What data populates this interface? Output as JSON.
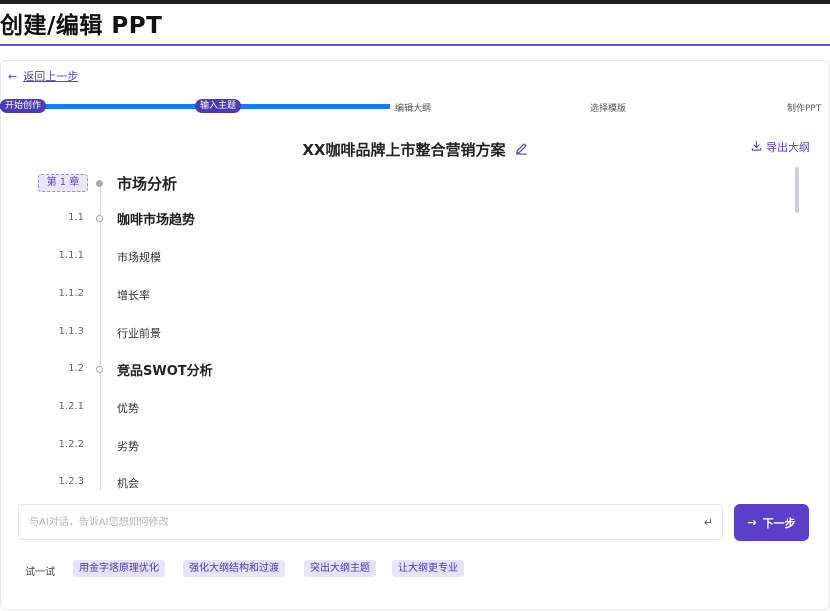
{
  "page": {
    "title": "创建/编辑 PPT"
  },
  "nav": {
    "back_label": "返回上一步",
    "back_icon": "arrow-left-icon"
  },
  "stepper": {
    "progress_percent": 47,
    "steps": [
      {
        "label": "开始创作",
        "status": "done"
      },
      {
        "label": "输入主题",
        "status": "done"
      },
      {
        "label": "编辑大纲",
        "status": "current"
      },
      {
        "label": "选择模版",
        "status": "todo"
      },
      {
        "label": "制作PPT",
        "status": "todo"
      }
    ]
  },
  "document": {
    "title": "XX咖啡品牌上市整合营销方案",
    "edit_icon": "pencil-icon",
    "export_label": "导出大纲",
    "export_icon": "download-icon"
  },
  "outline": {
    "chapter_badge": "第 1 章",
    "items": [
      {
        "num": "",
        "text": "市场分析",
        "level": 1
      },
      {
        "num": "1.1",
        "text": "咖啡市场趋势",
        "level": 2
      },
      {
        "num": "1.1.1",
        "text": "市场规模",
        "level": 3
      },
      {
        "num": "1.1.2",
        "text": "增长率",
        "level": 3
      },
      {
        "num": "1.1.3",
        "text": "行业前景",
        "level": 3
      },
      {
        "num": "1.2",
        "text": "竞品SWOT分析",
        "level": 2
      },
      {
        "num": "1.2.1",
        "text": "优势",
        "level": 3
      },
      {
        "num": "1.2.2",
        "text": "劣势",
        "level": 3
      },
      {
        "num": "1.2.3",
        "text": "机会",
        "level": 3
      }
    ]
  },
  "chat": {
    "placeholder": "与AI对话，告诉AI您想如何修改",
    "enter_icon": "enter-icon"
  },
  "next_button": {
    "label": "下一步",
    "icon": "arrow-right-icon"
  },
  "suggestions": {
    "label": "试一试",
    "items": [
      "用金字塔原理优化",
      "强化大纲结构和过渡",
      "突出大纲主题",
      "让大纲更专业"
    ]
  },
  "colors": {
    "accent": "#5b3fc9",
    "progress": "#1677ff",
    "chip_bg": "#e8e2fa"
  }
}
